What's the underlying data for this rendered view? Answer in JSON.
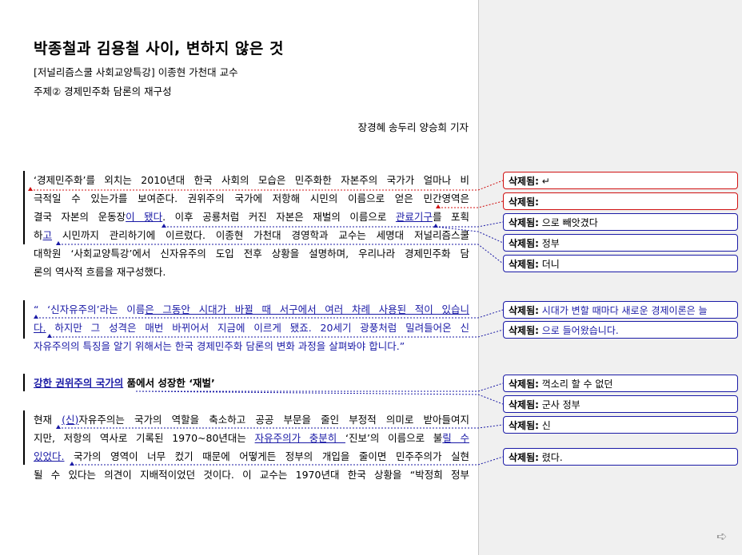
{
  "doc": {
    "title": "박종철과 김용철 사이, 변하지 않은 것",
    "subtitle1": "[저널리즘스쿨 사회교양특강] 이종현 가천대 교수",
    "subtitle2": "주제② 경제민주화 담론의 재구성",
    "byline": "장경혜 송두리 양승희 기자"
  },
  "p1": {
    "l1": "‘경제민주화’를 외치는 2010년대 한국 사회의 모습은 민주화한 자본주의 국가가 얼마나 비",
    "l2": "극적일 수 있는가를 보여준다. 권위주의 국가에 저항해 시민의 이름으로 얻은 민간영역은",
    "l3a": "결국 자본의 운동장",
    "l3b": "이 됐다",
    "l3c": ". 이후 공룡처럼 커진 자본은 재벌의 이름으로 ",
    "l3d": "관료기구",
    "l3e": "를 포획",
    "l4a": "하",
    "l4b": "고",
    "l4c": " 시민까지 관리하기에 이르렀다. 이종현 가천대 경영학과 교수는 세명대 저널리즘스쿨",
    "l5": "대학원 ‘사회교양특강’에서 신자유주의 도입 전후 상황을 설명하며, 우리나라 경제민주화 담",
    "l6": "론의 역사적 흐름을 재구성했다."
  },
  "p2": {
    "l1a": "“ ‘신자유주의’라는 이름",
    "l1b": "은 그동안 시대가 바뀔 때 서구에서 여러 차례 사용된 적이 있습니",
    "l2a": "다.",
    "l2b": " 하지만 그 성격은 매번 바뀌어서 지금에 이르게 됐죠. 20세기 광풍처럼 밀려들어온 신",
    "l3": "자유주의의 특징을 알기 위해서는 한국 경제민주화 담론의 변화 과정을 살펴봐야 합니다.”"
  },
  "heading": {
    "a": "강한 권위주의 국가의",
    "b": " 품에서 성장한 ‘재벌’"
  },
  "p3": {
    "l1a": "현재 ",
    "l1b": "(신)",
    "l1c": "자유주의는 국가의 역할을 축소하고 공공 부문을 줄인 부정적 의미로 받아들여지",
    "l2a": "지만, 저항의 역사로 기록된 1970~80년대는 ",
    "l2b": "자유주의가 충분히 ",
    "l2c": "‘진보’의 이름으로 불",
    "l2d": "릴 수",
    "l3a": "있었다.",
    "l3b": " 국가의 영역이 너무 컸기 때문에 어떻게든 정부의 개입을 줄이면 민주주의가 실현",
    "l4": "될 수 있다는 의견이 지배적이었던 것이다. 이 교수는 1970년대 한국 상황을 “박정희 정부"
  },
  "comments": [
    {
      "label": "삭제됨:",
      "text": "↵"
    },
    {
      "label": "삭제됨:",
      "text": ""
    },
    {
      "label": "삭제됨:",
      "text": "으로 빼앗겼다"
    },
    {
      "label": "삭제됨:",
      "text": "정부"
    },
    {
      "label": "삭제됨:",
      "text": "더니"
    },
    {
      "label": "삭제됨:",
      "text": "시대가 변할 때마다 새로운 경제이론은 늘"
    },
    {
      "label": "삭제됨:",
      "text": "으로 들어왔습니다."
    },
    {
      "label": "삭제됨:",
      "text": "꺽소리 할 수 없던"
    },
    {
      "label": "삭제됨:",
      "text": "군사 정부"
    },
    {
      "label": "삭제됨:",
      "text": "신"
    },
    {
      "label": "삭제됨:",
      "text": "렸다."
    }
  ],
  "colors": {
    "insert": "#1a1aa6",
    "delete_border": "#d01010",
    "balloon_border": "#1a1aa6"
  }
}
